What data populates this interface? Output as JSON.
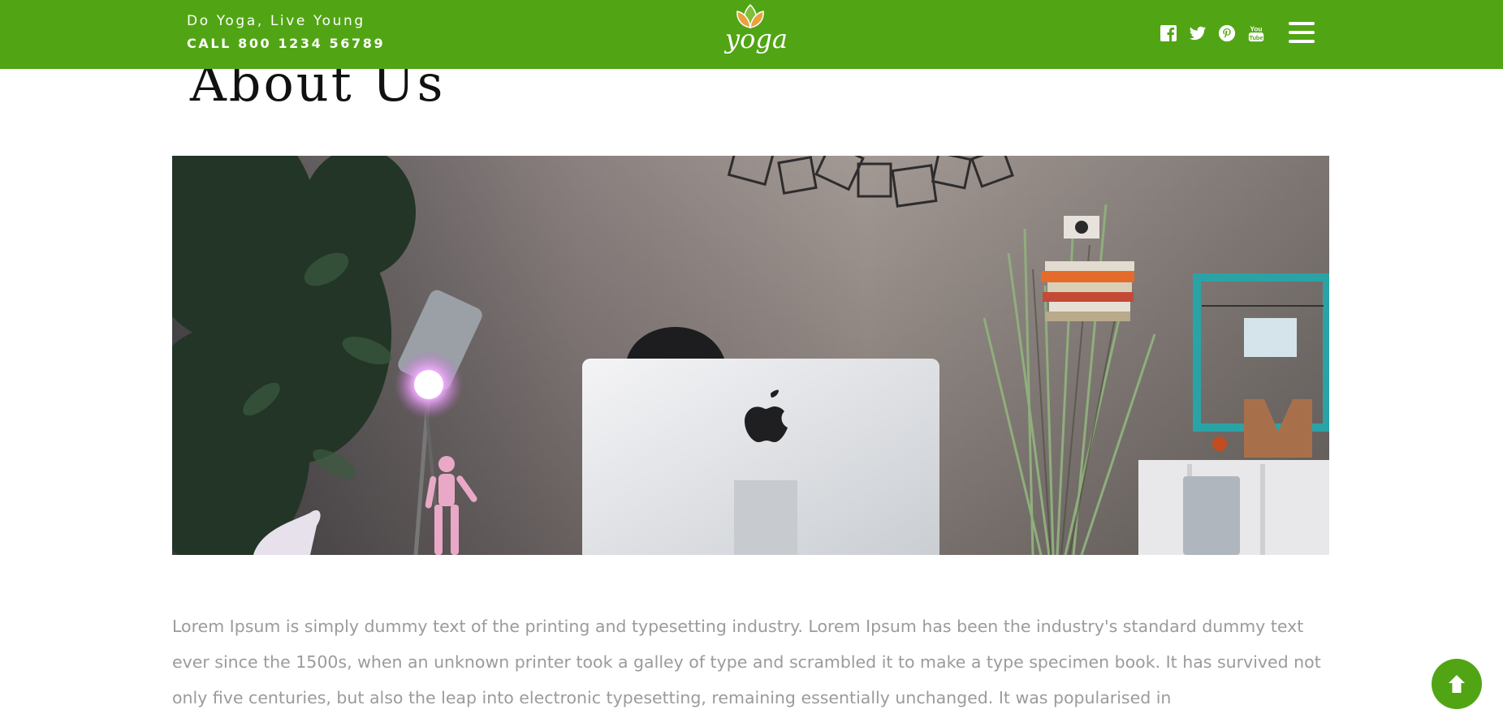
{
  "header": {
    "tagline": "Do Yoga, Live Young",
    "phone": "CALL 800 1234 56789",
    "logo_text": "yoga",
    "socials": [
      "facebook-icon",
      "twitter-icon",
      "pinterest-icon",
      "youtube-icon"
    ],
    "menu_icon": "hamburger-menu-icon"
  },
  "page": {
    "title": "About Us",
    "body": "Lorem Ipsum is simply dummy text of the printing and typesetting industry. Lorem Ipsum has been the industry's standard dummy text ever since the 1500s, when an unknown printer took a galley of type and scrambled it to make a type specimen book. It has survived not only five centuries, but also the leap into electronic typesetting, remaining essentially unchanged. It was popularised in"
  },
  "scroll_top": {
    "icon": "arrow-up-icon"
  },
  "colors": {
    "brand_green": "#51a514",
    "title": "#111111",
    "body_text": "#9b9b9b"
  }
}
